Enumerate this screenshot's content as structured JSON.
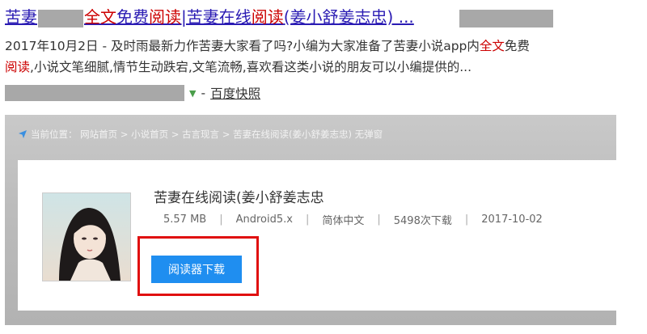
{
  "result": {
    "title_part1": "苦妻",
    "title_hl1": "全文",
    "title_part2": "免费",
    "title_hl2": "阅读",
    "title_part3": "|苦妻在线",
    "title_hl3": "阅读",
    "title_part4": "(姜小舒姜志忠) ...",
    "snippet_date": "2017年10月2日",
    "snippet_part1": " - 及时雨最新力作苦妻大家看了吗?小编为大家准备了苦妻小说app内",
    "snippet_hl1": "全文",
    "snippet_part2": "免费",
    "snippet_hl2": "阅读",
    "snippet_part3": ",小说文笔细腻,情节生动跌宕,文笔流畅,喜欢看这类小说的朋友可以小编提供的...",
    "snapshot_sep": "-",
    "snapshot_link": "百度快照"
  },
  "page": {
    "breadcrumb": "当前位置： 网站首页 > 小说首页 > 古言现言 > 苦妻在线阅读(姜小舒姜志忠) 无弹窗",
    "app_title": "苦妻在线阅读(姜小舒姜志忠",
    "meta": {
      "size": "5.57 MB",
      "platform": "Android5.x",
      "language": "简体中文",
      "downloads": "5498次下载",
      "date": "2017-10-02"
    },
    "download_button": "阅读器下载"
  },
  "colors": {
    "link": "#2a1bb3",
    "highlight": "#cc0000",
    "button": "#1f8ef0",
    "annotation_box": "#e01010"
  }
}
